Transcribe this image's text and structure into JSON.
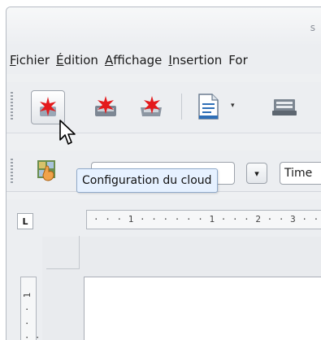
{
  "window": {
    "title_fragment": "s"
  },
  "menubar": {
    "items": [
      {
        "mnemonic": "F",
        "rest": "ichier"
      },
      {
        "mnemonic": "É",
        "rest": "dition"
      },
      {
        "mnemonic": "A",
        "rest": "ffichage"
      },
      {
        "mnemonic": "I",
        "rest": "nsertion"
      },
      {
        "mnemonic": "",
        "rest": "For"
      }
    ]
  },
  "toolbar": {
    "buttons": [
      {
        "icon": "cloud-config-star-icon",
        "state": "hover"
      },
      {
        "icon": "cloud-open-star-icon"
      },
      {
        "icon": "cloud-save-star-icon"
      },
      {
        "icon": "new-document-icon"
      },
      {
        "icon": "open-folder-icon"
      }
    ],
    "dropdown_glyph": "▾"
  },
  "toolbar2": {
    "font_name_value": "Time",
    "style_dropdown_glyph": "▾"
  },
  "tooltip": {
    "text": "Configuration du cloud"
  },
  "ruler": {
    "horizontal_text": "· · · 1 · · · · · · 1 · · · 2 · · 3 · ·",
    "vertical_text": "· · · 1 ·",
    "corner_glyph": "L"
  },
  "colors": {
    "star_red": "#e41a1c",
    "tooltip_bg": "#e6f1ff",
    "doc_icon_blue": "#2f6fb7"
  }
}
